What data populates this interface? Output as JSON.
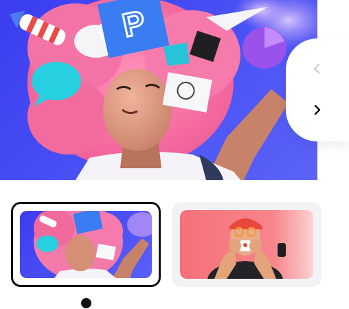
{
  "carousel": {
    "hero": {
      "image": "3d-character-pink-hair-with-creative-tools"
    },
    "nav": {
      "prev_icon": "chevron-left-icon",
      "next_icon": "chevron-right-icon",
      "prev_disabled": true
    },
    "slides": [
      {
        "image": "3d-character-pink-hair-with-creative-tools",
        "selected": true
      },
      {
        "image": "3d-character-drinking-coffee",
        "selected": false
      }
    ],
    "active_index": 0,
    "colors": {
      "hero_bg": "#3b3df0",
      "thumb2_bg": "#f5707a",
      "selected_border": "#111111",
      "dot": "#111111"
    }
  }
}
